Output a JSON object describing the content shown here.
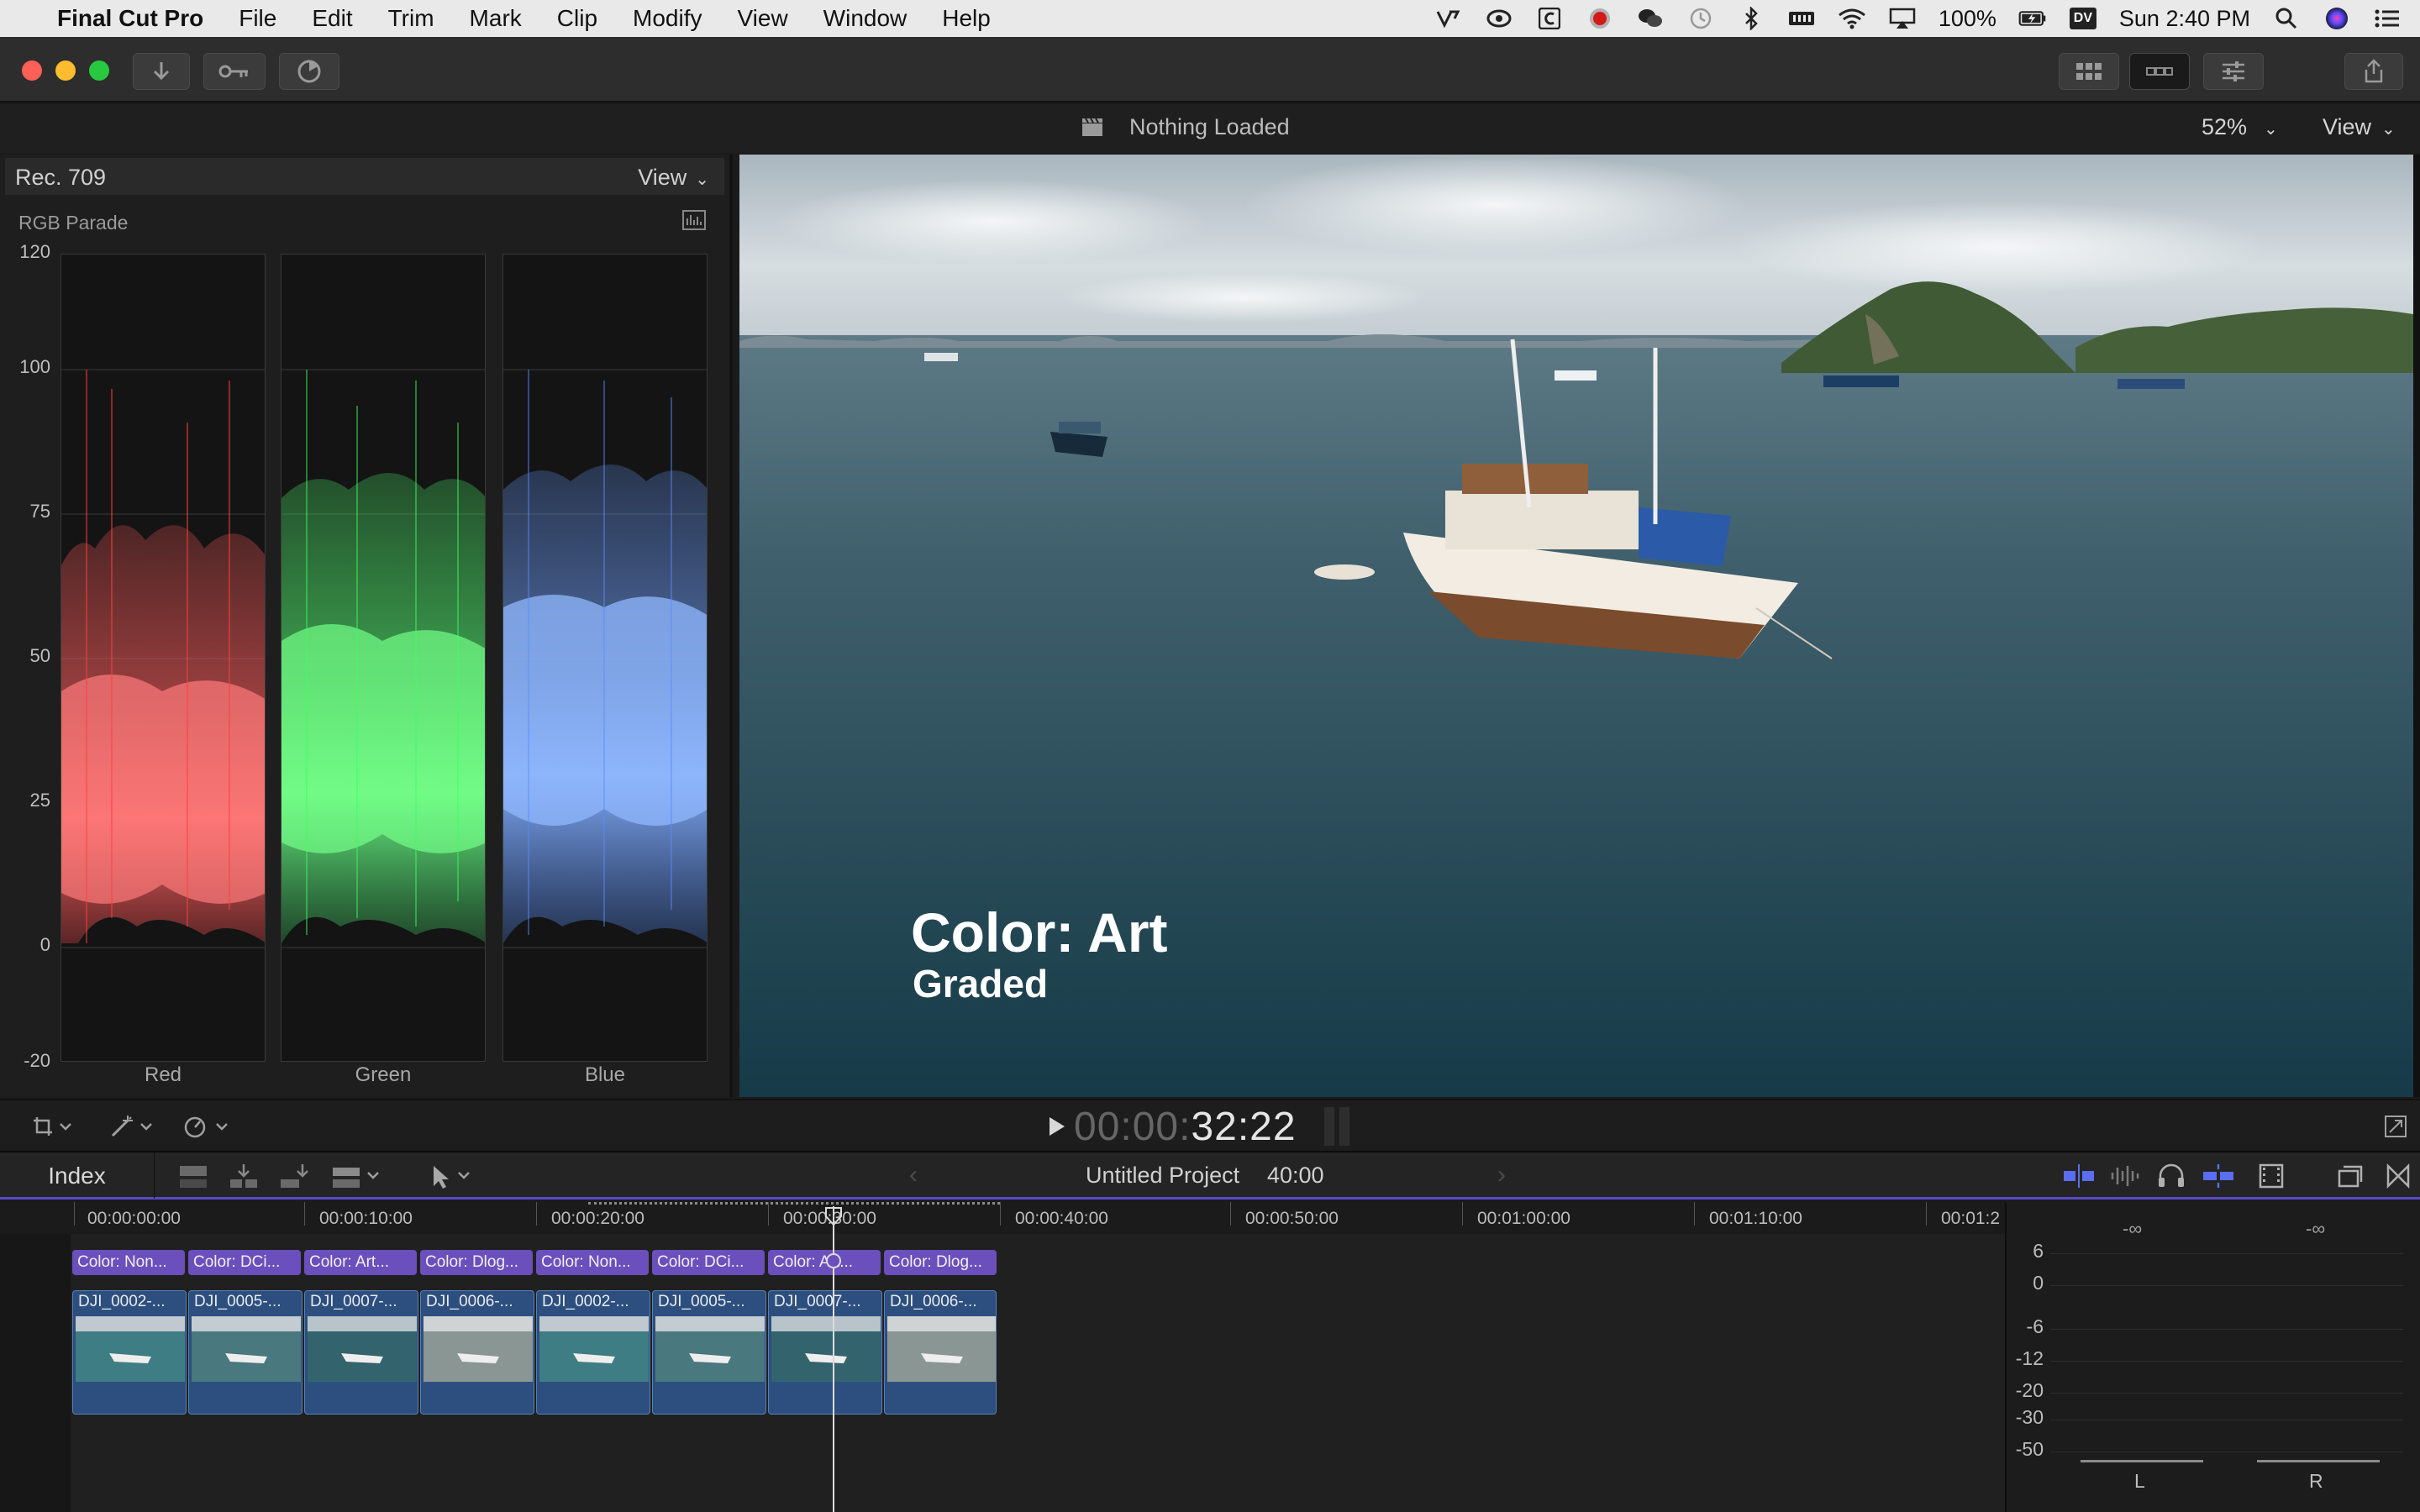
{
  "menubar": {
    "app": "Final Cut Pro",
    "items": [
      "File",
      "Edit",
      "Trim",
      "Mark",
      "Clip",
      "Modify",
      "View",
      "Window",
      "Help"
    ],
    "battery": "100%",
    "dv_badge": "DV",
    "clock": "Sun 2:40 PM"
  },
  "viewer": {
    "status": "Nothing Loaded",
    "zoom": "52%",
    "view_menu": "View",
    "title_main": "Color: Art",
    "title_sub": "Graded"
  },
  "scope": {
    "standard": "Rec. 709",
    "view_menu": "View",
    "type": "RGB Parade",
    "y_ticks": [
      "120",
      "100",
      "75",
      "50",
      "25",
      "0",
      "-20"
    ],
    "channels": [
      "Red",
      "Green",
      "Blue"
    ]
  },
  "transport": {
    "timecode_dim": "00:00:",
    "timecode_bright": "32:22"
  },
  "timeline_header": {
    "index": "Index",
    "project": "Untitled Project",
    "duration": "40:00"
  },
  "ruler": [
    "00:00:00:00",
    "00:00:10:00",
    "00:00:20:00",
    "00:00:30:00",
    "00:00:40:00",
    "00:00:50:00",
    "00:01:00:00",
    "00:01:10:00",
    "00:01:2"
  ],
  "title_clips": [
    "Color: Non...",
    "Color: DCi...",
    "Color: Art...",
    "Color: Dlog...",
    "Color: Non...",
    "Color: DCi...",
    "Color: Art...",
    "Color: Dlog..."
  ],
  "video_clips": [
    "DJI_0002-...",
    "DJI_0005-...",
    "DJI_0007-...",
    "DJI_0006-...",
    "DJI_0002-...",
    "DJI_0005-...",
    "DJI_0007-...",
    "DJI_0006-..."
  ],
  "meters": {
    "db_scale": [
      "6",
      "0",
      "-6",
      "-12",
      "-20",
      "-30",
      "-50"
    ],
    "peak_left": "-∞",
    "peak_right": "-∞",
    "left_label": "L",
    "right_label": "R"
  }
}
